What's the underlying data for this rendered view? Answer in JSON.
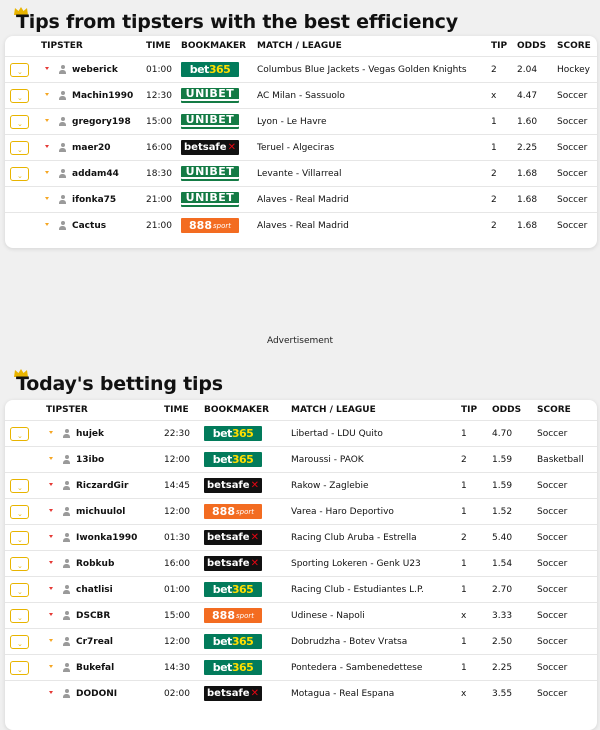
{
  "section1": {
    "title": "Tips from tipsters with the best efficiency",
    "headers": {
      "tipster": "TIPSTER",
      "time": "TIME",
      "bookmaker": "BOOKMAKER",
      "match": "MATCH / LEAGUE",
      "tip": "TIP",
      "odds": "ODDS",
      "score": "SCORE"
    },
    "rows": [
      {
        "fav": true,
        "trend": "down",
        "tipster": "weberick",
        "time": "01:00",
        "bookmaker": "bet365",
        "match": "Columbus Blue Jackets - Vegas Golden Knights",
        "tip": "2",
        "odds": "2.04",
        "sport": "Hockey"
      },
      {
        "fav": true,
        "trend": "up",
        "tipster": "Machin1990",
        "time": "12:30",
        "bookmaker": "unibet",
        "match": "AC Milan - Sassuolo",
        "tip": "x",
        "odds": "4.47",
        "sport": "Soccer"
      },
      {
        "fav": true,
        "trend": "up",
        "tipster": "gregory198",
        "time": "15:00",
        "bookmaker": "unibet",
        "match": "Lyon - Le Havre",
        "tip": "1",
        "odds": "1.60",
        "sport": "Soccer"
      },
      {
        "fav": true,
        "trend": "down",
        "tipster": "maer20",
        "time": "16:00",
        "bookmaker": "betsafe",
        "match": "Teruel - Algeciras",
        "tip": "1",
        "odds": "2.25",
        "sport": "Soccer"
      },
      {
        "fav": true,
        "trend": "up",
        "tipster": "addam44",
        "time": "18:30",
        "bookmaker": "unibet",
        "match": "Levante - Villarreal",
        "tip": "2",
        "odds": "1.68",
        "sport": "Soccer"
      },
      {
        "fav": false,
        "trend": "up",
        "tipster": "ifonka75",
        "time": "21:00",
        "bookmaker": "unibet",
        "match": "Alaves - Real Madrid",
        "tip": "2",
        "odds": "1.68",
        "sport": "Soccer"
      },
      {
        "fav": false,
        "trend": "up",
        "tipster": "Cactus",
        "time": "21:00",
        "bookmaker": "888sport",
        "match": "Alaves - Real Madrid",
        "tip": "2",
        "odds": "1.68",
        "sport": "Soccer"
      }
    ]
  },
  "advertisement": "Advertisement",
  "section2": {
    "title": "Today's betting tips",
    "headers": {
      "tipster": "TIPSTER",
      "time": "TIME",
      "bookmaker": "BOOKMAKER",
      "match": "MATCH / LEAGUE",
      "tip": "TIP",
      "odds": "ODDS",
      "score": "SCORE"
    },
    "rows": [
      {
        "fav": true,
        "trend": "up",
        "tipster": "hujek",
        "time": "22:30",
        "bookmaker": "bet365",
        "match": "Libertad - LDU Quito",
        "tip": "1",
        "odds": "4.70",
        "sport": "Soccer"
      },
      {
        "fav": false,
        "trend": "up",
        "tipster": "13ibo",
        "time": "12:00",
        "bookmaker": "bet365",
        "match": "Maroussi - PAOK",
        "tip": "2",
        "odds": "1.59",
        "sport": "Basketball"
      },
      {
        "fav": true,
        "trend": "down",
        "tipster": "RiczardGir",
        "time": "14:45",
        "bookmaker": "betsafe",
        "match": "Rakow - Zaglebie",
        "tip": "1",
        "odds": "1.59",
        "sport": "Soccer"
      },
      {
        "fav": true,
        "trend": "down",
        "tipster": "michuulol",
        "time": "12:00",
        "bookmaker": "888sport",
        "match": "Varea - Haro Deportivo",
        "tip": "1",
        "odds": "1.52",
        "sport": "Soccer"
      },
      {
        "fav": true,
        "trend": "down",
        "tipster": "Iwonka1990",
        "time": "01:30",
        "bookmaker": "betsafe",
        "match": "Racing Club Aruba - Estrella",
        "tip": "2",
        "odds": "5.40",
        "sport": "Soccer"
      },
      {
        "fav": true,
        "trend": "down",
        "tipster": "Robkub",
        "time": "16:00",
        "bookmaker": "betsafe",
        "match": "Sporting Lokeren - Genk U23",
        "tip": "1",
        "odds": "1.54",
        "sport": "Soccer"
      },
      {
        "fav": true,
        "trend": "down",
        "tipster": "chatlisi",
        "time": "01:00",
        "bookmaker": "bet365",
        "match": "Racing Club - Estudiantes L.P.",
        "tip": "1",
        "odds": "2.70",
        "sport": "Soccer"
      },
      {
        "fav": true,
        "trend": "down",
        "tipster": "DSCBR",
        "time": "15:00",
        "bookmaker": "888sport",
        "match": "Udinese - Napoli",
        "tip": "x",
        "odds": "3.33",
        "sport": "Soccer"
      },
      {
        "fav": true,
        "trend": "up",
        "tipster": "Cr7real",
        "time": "12:00",
        "bookmaker": "bet365",
        "match": "Dobrudzha - Botev Vratsa",
        "tip": "1",
        "odds": "2.50",
        "sport": "Soccer"
      },
      {
        "fav": true,
        "trend": "up",
        "tipster": "Bukefal",
        "time": "14:30",
        "bookmaker": "bet365",
        "match": "Pontedera - Sambenedettese",
        "tip": "1",
        "odds": "2.25",
        "sport": "Soccer"
      },
      {
        "fav": false,
        "trend": "down",
        "tipster": "DODONI",
        "time": "02:00",
        "bookmaker": "betsafe",
        "match": "Motagua - Real Espana",
        "tip": "x",
        "odds": "3.55",
        "sport": "Soccer"
      }
    ]
  },
  "logos": {
    "bet365": {
      "a": "bet",
      "b": "365"
    },
    "unibet": {
      "a": "UNIBET"
    },
    "betsafe": {
      "a": "betsafe",
      "b": "✕"
    },
    "888sport": {
      "a": "888",
      "b": "sport"
    }
  },
  "colors": {
    "accent": "#e8b400",
    "trend_down": "#e53935",
    "trend_up": "#f5a623",
    "bet365": "#027b5b",
    "unibet": "#147b45",
    "betsafe": "#111111",
    "sport888": "#f36c21"
  }
}
